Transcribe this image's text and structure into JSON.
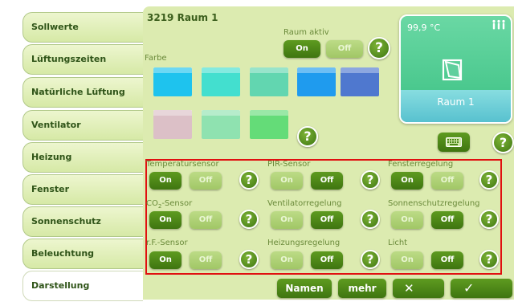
{
  "sidebar": {
    "tabs": [
      {
        "label": "Sollwerte"
      },
      {
        "label": "Lüftungszeiten"
      },
      {
        "label": "Natürliche Lüftung"
      },
      {
        "label": "Ventilator"
      },
      {
        "label": "Heizung"
      },
      {
        "label": "Fenster"
      },
      {
        "label": "Sonnenschutz"
      },
      {
        "label": "Beleuchtung"
      },
      {
        "label": "Darstellung",
        "active": true
      }
    ]
  },
  "header": {
    "title": "3219 Raum 1"
  },
  "raum_aktiv": {
    "label": "Raum aktiv",
    "on": "On",
    "off": "Off",
    "state": "on"
  },
  "farbe": {
    "label": "Farbe",
    "swatches": [
      "#1ec3ee",
      "#43dfcf",
      "#62d6b0",
      "#1f9bee",
      "#4f78cf",
      "#dcc0c7",
      "#8fe2b0",
      "#64dc78"
    ]
  },
  "card": {
    "temperature": "99,9 °C",
    "name": "Raum 1",
    "icon": "window-tilt-icon",
    "people_icon": "people-icon"
  },
  "keyboard_icon": "keyboard-icon",
  "help_text": "?",
  "sensors": [
    {
      "label": "Temperatursensor",
      "on": "On",
      "off": "Off",
      "state": "on"
    },
    {
      "label": "PIR-Sensor",
      "on": "On",
      "off": "Off",
      "state": "off"
    },
    {
      "label": "Fensterregelung",
      "on": "On",
      "off": "Off",
      "state": "on"
    },
    {
      "label_pre": "CO",
      "label_sub": "2",
      "label_post": "-Sensor",
      "on": "On",
      "off": "Off",
      "state": "on"
    },
    {
      "label": "Ventilatorregelung",
      "on": "On",
      "off": "Off",
      "state": "off"
    },
    {
      "label": "Sonnenschutzregelung",
      "on": "On",
      "off": "Off",
      "state": "off"
    },
    {
      "label": "r.F.-Sensor",
      "on": "On",
      "off": "Off",
      "state": "on"
    },
    {
      "label": "Heizungsregelung",
      "on": "On",
      "off": "Off",
      "state": "off"
    },
    {
      "label": "Licht",
      "on": "On",
      "off": "Off",
      "state": "off"
    }
  ],
  "footer": {
    "names": "Namen",
    "more": "mehr",
    "cancel_icon": "close-icon",
    "confirm_icon": "check-icon",
    "cancel": "✕",
    "confirm": "✓"
  },
  "colors": {
    "accent": "#4a8618",
    "panel": "#dcebb0",
    "highlight": "#e01010"
  }
}
